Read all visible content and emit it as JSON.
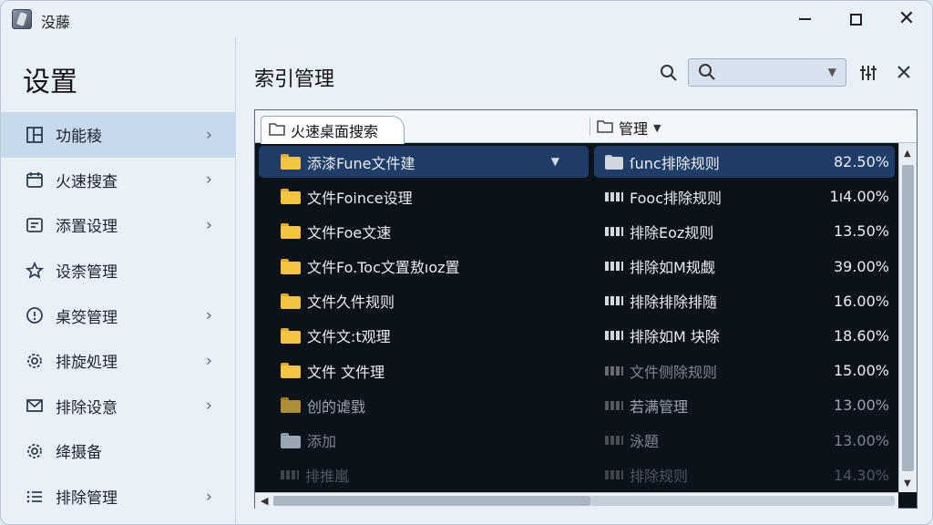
{
  "window": {
    "title": "没藤",
    "minimize_label": "",
    "maximize_label": "",
    "close_label": "✕"
  },
  "sidebar": {
    "title": "设置",
    "items": [
      {
        "label": "功能稜",
        "icon": "layout-icon",
        "active": true
      },
      {
        "label": "火速搜査",
        "icon": "calendar-icon"
      },
      {
        "label": "添置设理",
        "icon": "list-panel-icon"
      },
      {
        "label": "设柰管理",
        "icon": "star-icon"
      },
      {
        "label": "桌筊管理",
        "icon": "info-circle-icon"
      },
      {
        "label": "排旋処理",
        "icon": "gear-icon"
      },
      {
        "label": "排除设意",
        "icon": "mail-icon"
      },
      {
        "label": "绛摄备",
        "icon": "gear-icon"
      },
      {
        "label": "排除管理",
        "icon": "list-icon"
      }
    ]
  },
  "main": {
    "title": "索引管理",
    "search": {
      "placeholder": "",
      "value": ""
    },
    "tab": {
      "label": "火速桌面搜索"
    },
    "manage": {
      "label": "管理"
    },
    "rows": [
      {
        "left": "添漆Fune文件建",
        "right": "ſunc排除规则",
        "pct": "82.50%"
      },
      {
        "left": "文件Foince设理",
        "right": "Fooc排除规则",
        "pct": "1ı4.00%"
      },
      {
        "left": "文件Foe文速",
        "right": "排除Eoz规则",
        "pct": "13.50%"
      },
      {
        "left": "文件Fo.Toc文置敖ıoz置",
        "right": "排除如M规觑",
        "pct": "39.00%"
      },
      {
        "left": "文件久件规则",
        "right": "排除排除排隨",
        "pct": "16.00%"
      },
      {
        "left": "文件文:t观理",
        "right": "排除如M 块除",
        "pct": "18.60%"
      },
      {
        "left": "文件 文件理",
        "right": "文件侧除规则",
        "pct": "15.00%"
      },
      {
        "left": "创的谑戥",
        "right": "若满管理",
        "pct": "13.00%"
      },
      {
        "left": "添加",
        "right": "泳題",
        "pct": "13.00%"
      },
      {
        "left": "排推嵐",
        "right": "排除规则",
        "pct": "14.30%"
      }
    ]
  },
  "colors": {
    "panel_bg": "#0c1219",
    "selected_row": "#1f3d66",
    "sidebar_active": "#c9d9ec",
    "window_bg": "#e9f0f8"
  }
}
